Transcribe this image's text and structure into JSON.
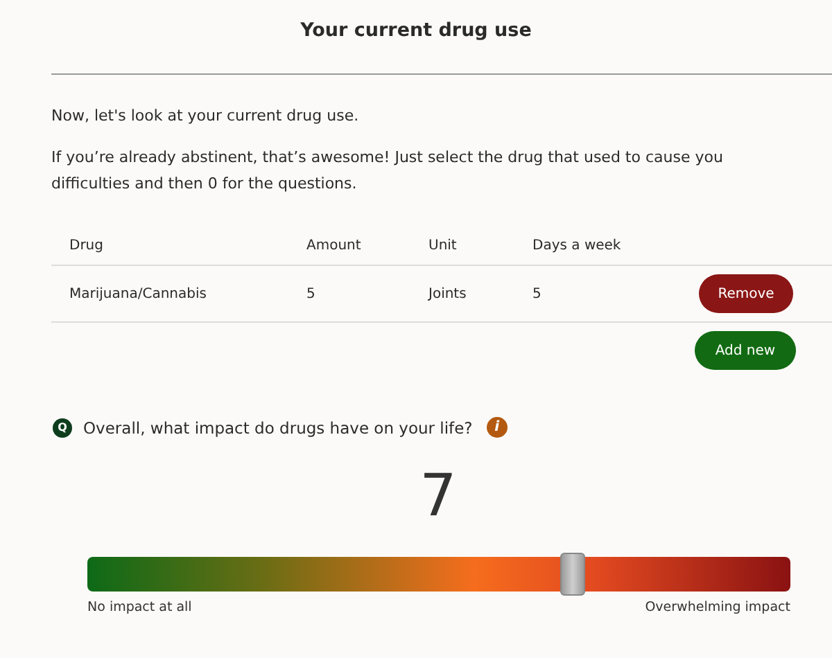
{
  "header": {
    "title": "Your current drug use"
  },
  "intro": [
    "Now, let's look at your current drug use.",
    "If you’re already abstinent, that’s awesome! Just select the drug that used to cause you difficulties and then 0 for the questions."
  ],
  "table": {
    "columns": [
      "Drug",
      "Amount",
      "Unit",
      "Days a week"
    ],
    "rows": [
      {
        "cells": [
          "Marijuana/Cannabis",
          "5",
          "Joints",
          "5"
        ],
        "action": "Remove"
      }
    ]
  },
  "add_button": "Add new",
  "question": {
    "badge": "Q",
    "text": "Overall, what impact do drugs have on your life?",
    "info": "i",
    "value": "7",
    "slider": {
      "level": 0.69
    },
    "min_label": "No impact at all",
    "max_label": "Overwhelming impact"
  }
}
